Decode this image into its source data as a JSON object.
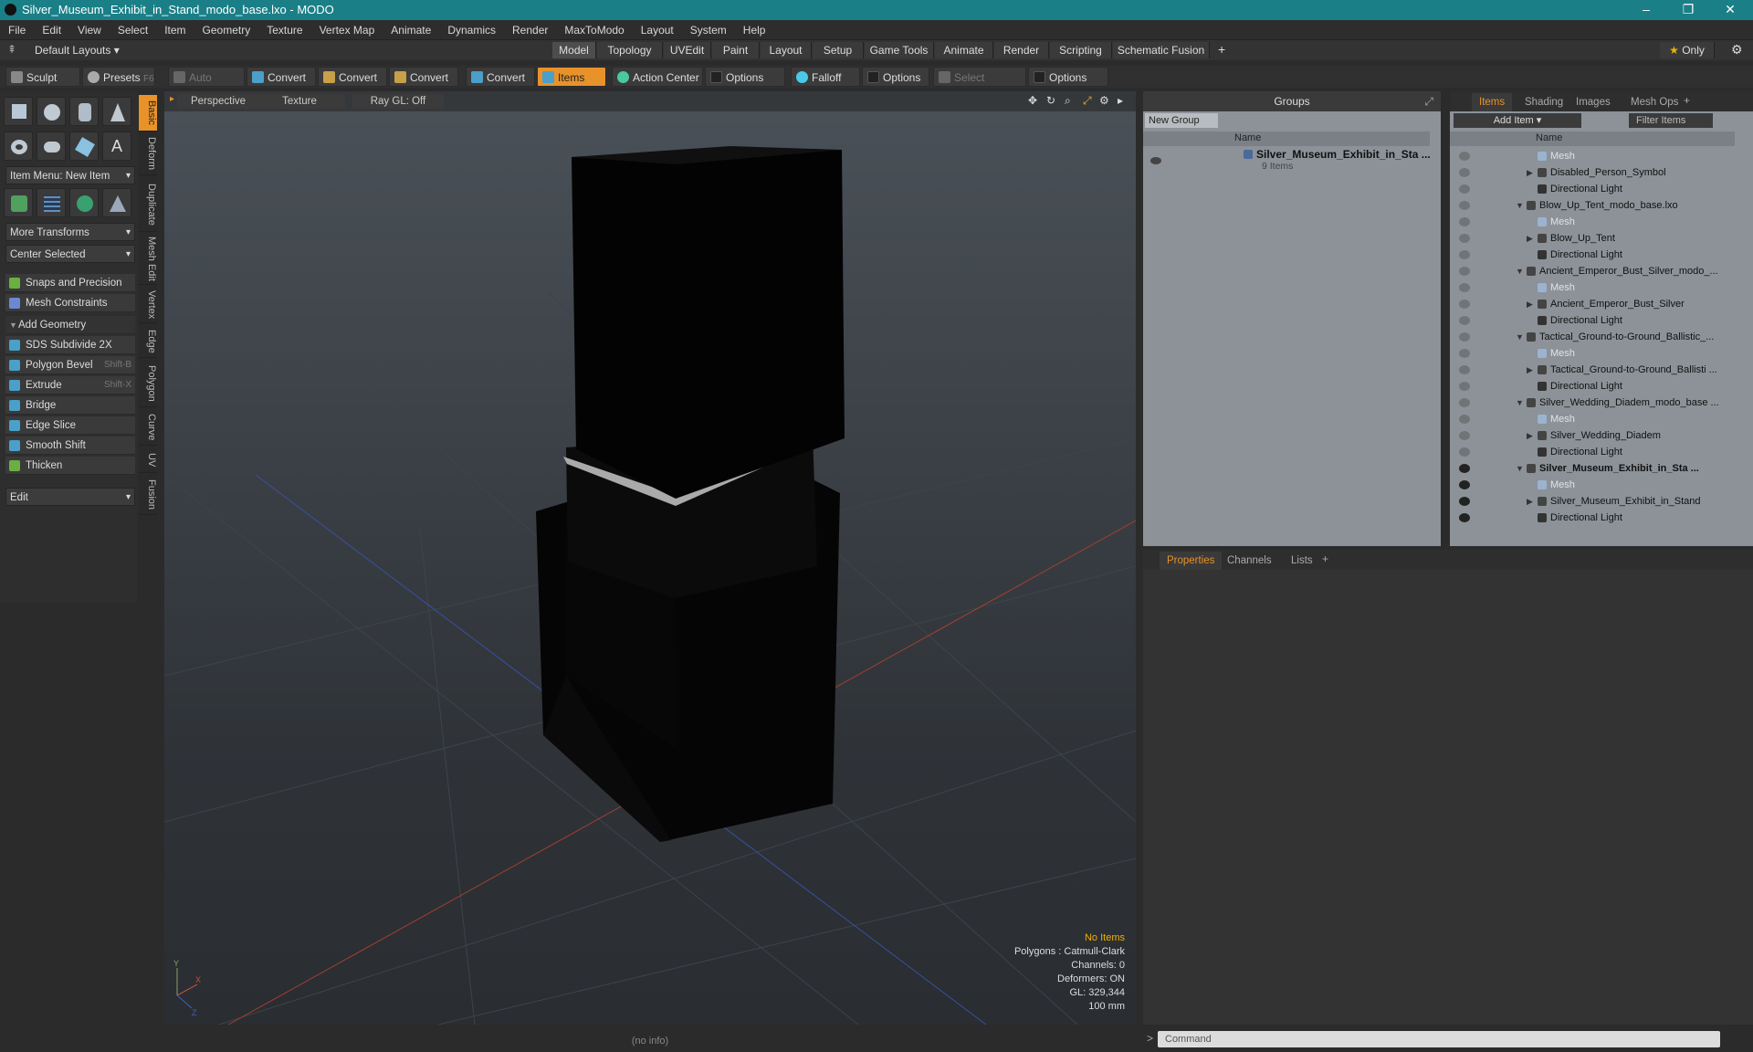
{
  "window": {
    "title": "Silver_Museum_Exhibit_in_Stand_modo_base.lxo - MODO"
  },
  "menu": [
    "File",
    "Edit",
    "View",
    "Select",
    "Item",
    "Geometry",
    "Texture",
    "Vertex Map",
    "Animate",
    "Dynamics",
    "Render",
    "MaxToModo",
    "Layout",
    "System",
    "Help"
  ],
  "layout_bar": {
    "layouts_label": "Default Layouts",
    "tabs": [
      "Model",
      "Topology",
      "UVEdit",
      "Paint",
      "Layout",
      "Setup",
      "Game Tools",
      "Animate",
      "Render",
      "Scripting",
      "Schematic Fusion"
    ],
    "active_tab": "Model",
    "only_label": "Only"
  },
  "toolbar": {
    "sculpt": "Sculpt",
    "presets": "Presets",
    "presets_shortcut": "F6",
    "auto_select": "Auto Select",
    "convert": "Convert",
    "items": "Items",
    "action_center": "Action Center",
    "options": "Options",
    "falloff": "Falloff",
    "select_through": "Select Through"
  },
  "left_panel": {
    "item_menu": "Item Menu: New Item",
    "more_transforms": "More Transforms",
    "center_selected": "Center Selected",
    "snaps": "Snaps and Precision",
    "mesh_constraints": "Mesh Constraints",
    "add_geometry": "Add Geometry",
    "tools": [
      {
        "label": "SDS Subdivide 2X",
        "shortcut": ""
      },
      {
        "label": "Polygon Bevel",
        "shortcut": "Shift-B"
      },
      {
        "label": "Extrude",
        "shortcut": "Shift-X"
      },
      {
        "label": "Bridge",
        "shortcut": ""
      },
      {
        "label": "Edge Slice",
        "shortcut": ""
      },
      {
        "label": "Smooth Shift",
        "shortcut": ""
      },
      {
        "label": "Thicken",
        "shortcut": ""
      }
    ],
    "edit": "Edit",
    "side_tabs": [
      "Basic",
      "Deform",
      "Duplicate",
      "Mesh Edit",
      "Vertex",
      "Edge",
      "Polygon",
      "Curve",
      "UV",
      "Fusion"
    ]
  },
  "viewport": {
    "view": "Perspective",
    "shading": "Texture",
    "raygl": "Ray GL: Off",
    "hud": {
      "selection": "No Items",
      "polygons": "Polygons : Catmull-Clark",
      "channels": "Channels: 0",
      "deformers": "Deformers: ON",
      "gl": "GL: 329,344",
      "scale": "100 mm"
    },
    "status": "(no info)"
  },
  "groups": {
    "title": "Groups",
    "new_group": "New Group",
    "name_header": "Name",
    "group_name": "Silver_Museum_Exhibit_in_Sta ...",
    "group_count": "9 Items"
  },
  "items_panel": {
    "tabs": [
      "Items",
      "Shading",
      "Images",
      "Mesh Ops"
    ],
    "add_item": "Add Item",
    "filter": "Filter Items",
    "name_header": "Name",
    "rows": [
      {
        "label": "Mesh",
        "kind": "mesh",
        "indent": 2
      },
      {
        "label": "Disabled_Person_Symbol",
        "kind": "item",
        "indent": 2
      },
      {
        "label": "Directional Light",
        "kind": "light",
        "indent": 2
      },
      {
        "label": "Blow_Up_Tent_modo_base.lxo",
        "kind": "scene",
        "indent": 1
      },
      {
        "label": "Mesh",
        "kind": "mesh",
        "indent": 2
      },
      {
        "label": "Blow_Up_Tent",
        "kind": "item",
        "indent": 2
      },
      {
        "label": "Directional Light",
        "kind": "light",
        "indent": 2
      },
      {
        "label": "Ancient_Emperor_Bust_Silver_modo_...",
        "kind": "scene",
        "indent": 1
      },
      {
        "label": "Mesh",
        "kind": "mesh",
        "indent": 2
      },
      {
        "label": "Ancient_Emperor_Bust_Silver",
        "kind": "item",
        "indent": 2
      },
      {
        "label": "Directional Light",
        "kind": "light",
        "indent": 2
      },
      {
        "label": "Tactical_Ground-to-Ground_Ballistic_...",
        "kind": "scene",
        "indent": 1
      },
      {
        "label": "Mesh",
        "kind": "mesh",
        "indent": 2
      },
      {
        "label": "Tactical_Ground-to-Ground_Ballisti ...",
        "kind": "item",
        "indent": 2
      },
      {
        "label": "Directional Light",
        "kind": "light",
        "indent": 2
      },
      {
        "label": "Silver_Wedding_Diadem_modo_base ...",
        "kind": "scene",
        "indent": 1
      },
      {
        "label": "Mesh",
        "kind": "mesh",
        "indent": 2
      },
      {
        "label": "Silver_Wedding_Diadem",
        "kind": "item",
        "indent": 2
      },
      {
        "label": "Directional Light",
        "kind": "light",
        "indent": 2
      },
      {
        "label": "Silver_Museum_Exhibit_in_Sta ...",
        "kind": "scene",
        "indent": 1,
        "bold": true
      },
      {
        "label": "Mesh",
        "kind": "mesh",
        "indent": 2
      },
      {
        "label": "Silver_Museum_Exhibit_in_Stand",
        "kind": "item",
        "indent": 2
      },
      {
        "label": "Directional Light",
        "kind": "light",
        "indent": 2
      }
    ]
  },
  "properties": {
    "tabs": [
      "Properties",
      "Channels",
      "Lists"
    ],
    "command_placeholder": "Command"
  },
  "colors": {
    "title_bar": "#1a7f86",
    "accent": "#e8922a"
  }
}
